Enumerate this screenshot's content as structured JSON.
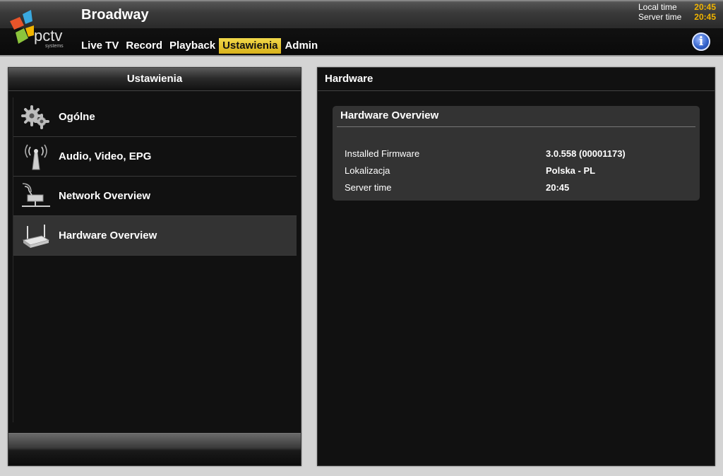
{
  "header": {
    "title": "Broadway",
    "logo_text": "pctv",
    "logo_subtext": "systems",
    "nav": [
      {
        "label": "Live TV",
        "active": false
      },
      {
        "label": "Record",
        "active": false
      },
      {
        "label": "Playback",
        "active": false
      },
      {
        "label": "Ustawienia",
        "active": true
      },
      {
        "label": "Admin",
        "active": false
      }
    ],
    "clock": {
      "local_label": "Local time",
      "local_value": "20:45",
      "server_label": "Server time",
      "server_value": "20:45"
    },
    "info_icon": "i"
  },
  "sidebar": {
    "title": "Ustawienia",
    "items": [
      {
        "label": "Ogólne",
        "icon": "gears-icon",
        "selected": false
      },
      {
        "label": "Audio, Video, EPG",
        "icon": "antenna-icon",
        "selected": false
      },
      {
        "label": "Network Overview",
        "icon": "network-icon",
        "selected": false
      },
      {
        "label": "Hardware Overview",
        "icon": "router-icon",
        "selected": true
      }
    ]
  },
  "main": {
    "title": "Hardware",
    "card": {
      "title": "Hardware Overview",
      "rows": [
        {
          "key": "Installed Firmware",
          "value": "3.0.558 (00001173)"
        },
        {
          "key": "Lokalizacja",
          "value": "Polska - PL"
        },
        {
          "key": "Server time",
          "value": "20:45"
        }
      ]
    }
  },
  "colors": {
    "accent": "#e8c530",
    "clock_value": "#f0b400"
  }
}
